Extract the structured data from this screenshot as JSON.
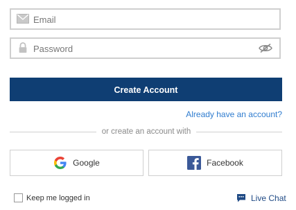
{
  "form": {
    "email_placeholder": "Email",
    "password_placeholder": "Password",
    "create_label": "Create Account",
    "signin_link": "Already have an account?",
    "divider_text": "or create an account with",
    "google_label": "Google",
    "facebook_label": "Facebook",
    "keep_logged_label": "Keep me logged in",
    "live_chat_label": "Live Chat"
  },
  "icons": {
    "email": "envelope-icon",
    "password": "lock-icon",
    "visibility": "eye-off-icon",
    "google": "google-logo-icon",
    "facebook": "facebook-logo-icon",
    "chat": "chat-bubble-icon"
  },
  "colors": {
    "primary": "#0f3e73",
    "link": "#2f7ccf",
    "facebook": "#3b5998"
  },
  "state": {
    "keep_logged_checked": false
  }
}
